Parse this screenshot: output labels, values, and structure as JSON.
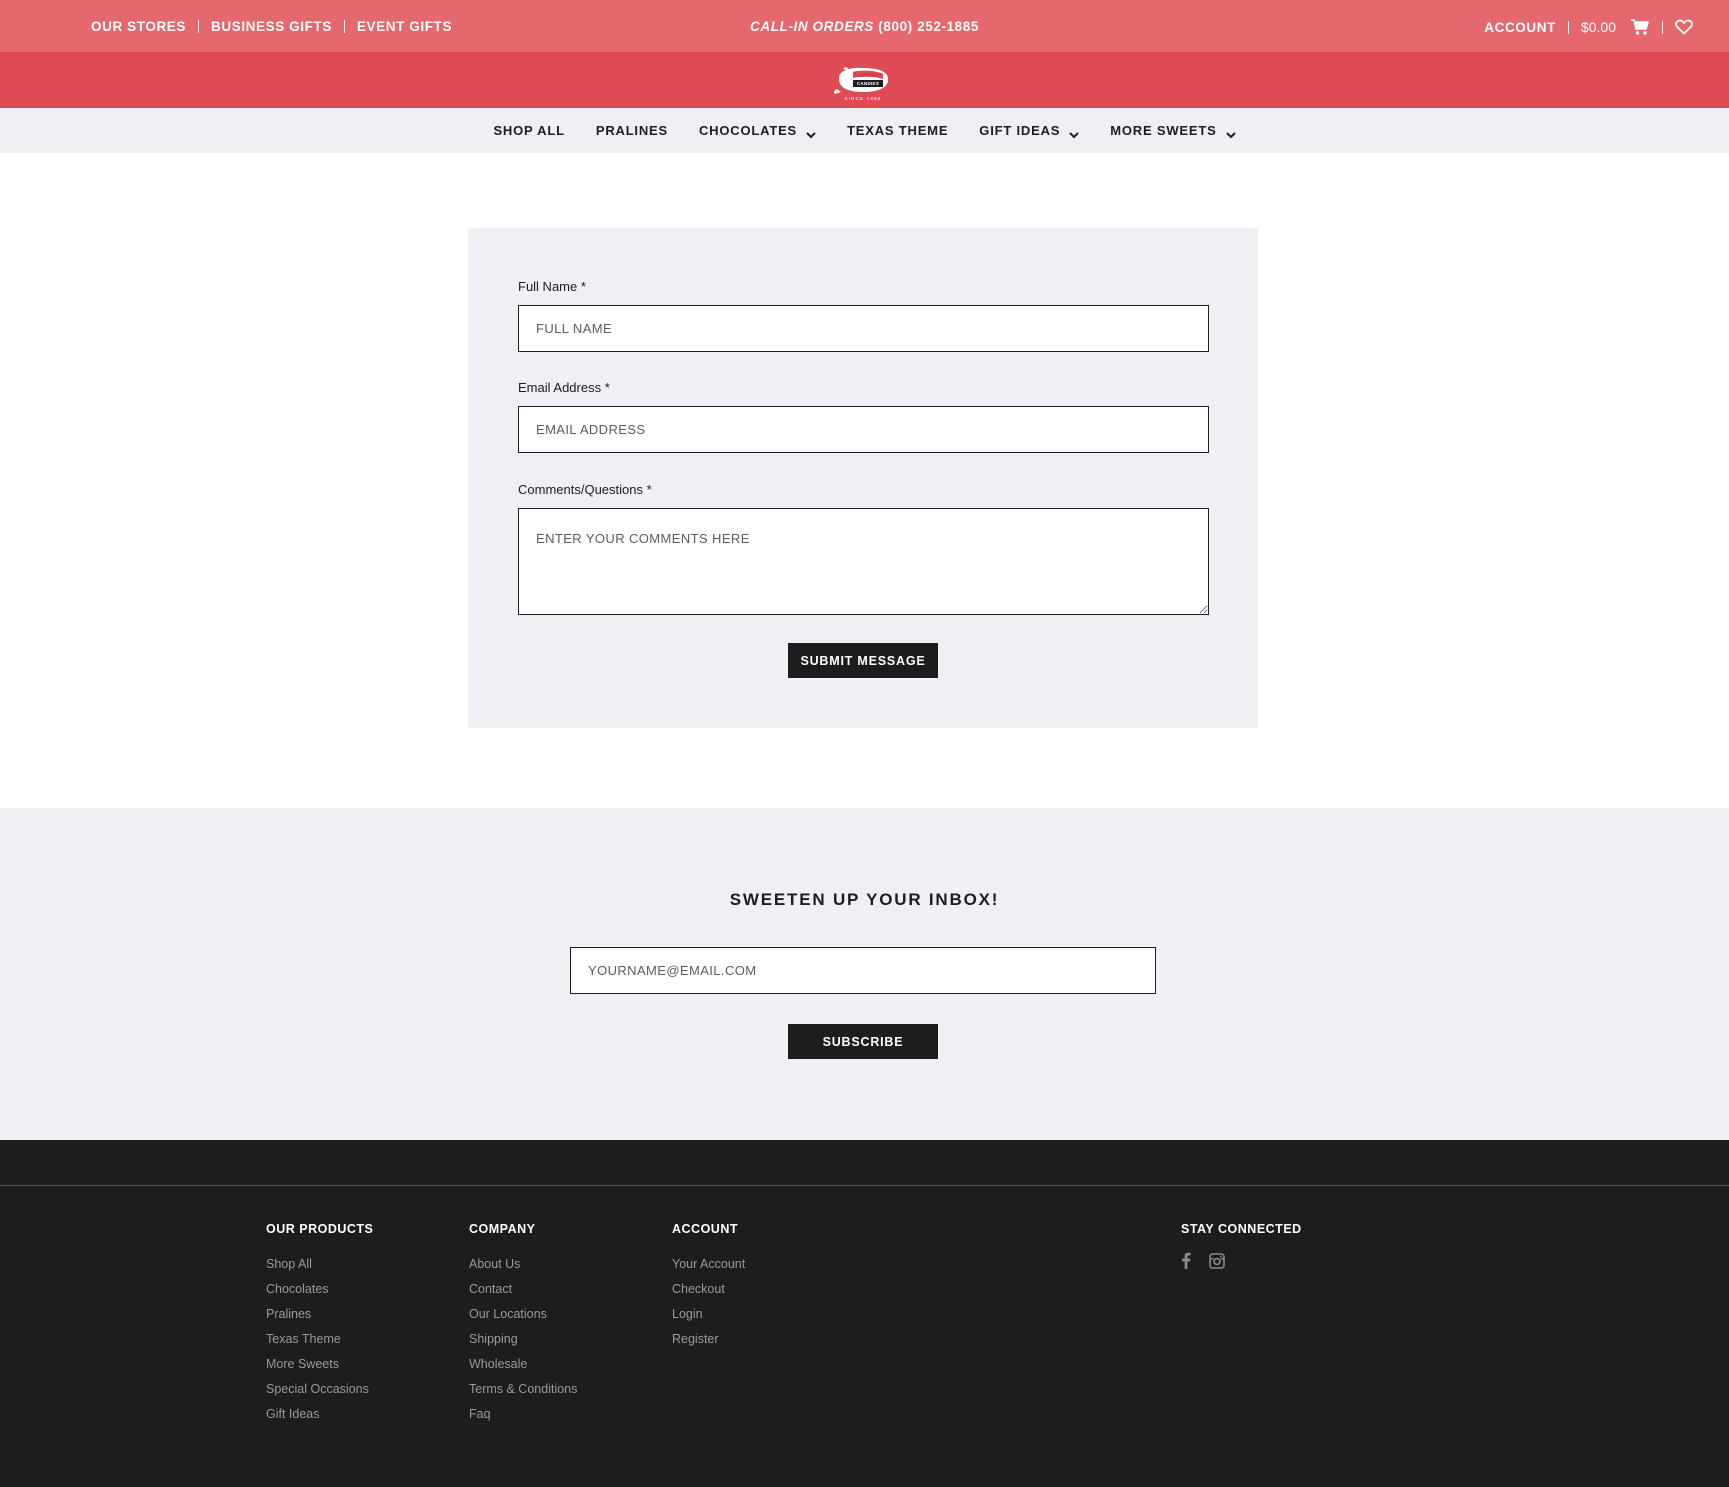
{
  "topbar": {
    "links": [
      "OUR STORES",
      "BUSINESS GIFTS",
      "EVENT GIFTS"
    ],
    "call_label": "CALL-IN ORDERS",
    "call_number": "(800) 252-1885",
    "account": "ACCOUNT",
    "cart_total": "$0.00",
    "cart_icon": "cart-icon",
    "wishlist_icon": "heart-icon"
  },
  "logo": {
    "name": "Lammes",
    "subtitle": "CANDIES",
    "since": "SINCE 1885"
  },
  "nav": {
    "items": [
      {
        "label": "SHOP ALL",
        "dropdown": false
      },
      {
        "label": "PRALINES",
        "dropdown": false
      },
      {
        "label": "CHOCOLATES",
        "dropdown": true
      },
      {
        "label": "TEXAS THEME",
        "dropdown": false
      },
      {
        "label": "GIFT IDEAS",
        "dropdown": true
      },
      {
        "label": "MORE SWEETS",
        "dropdown": true
      }
    ]
  },
  "form": {
    "full_name_label": "Full Name *",
    "full_name_placeholder": "FULL NAME",
    "email_label": "Email Address *",
    "email_placeholder": "EMAIL ADDRESS",
    "comments_label": "Comments/Questions *",
    "comments_placeholder": "ENTER YOUR COMMENTS HERE",
    "submit_label": "SUBMIT MESSAGE"
  },
  "newsletter": {
    "heading": "SWEETEN UP YOUR INBOX!",
    "email_placeholder": "YOURNAME@EMAIL.COM",
    "subscribe_label": "SUBSCRIBE"
  },
  "footer": {
    "products": {
      "heading": "OUR PRODUCTS",
      "links": [
        "Shop All",
        "Chocolates",
        "Pralines",
        "Texas Theme",
        "More Sweets",
        "Special Occasions",
        "Gift Ideas"
      ]
    },
    "company": {
      "heading": "COMPANY",
      "links": [
        "About Us",
        "Contact",
        "Our Locations",
        "Shipping",
        "Wholesale",
        "Terms & Conditions",
        "Faq"
      ]
    },
    "account": {
      "heading": "ACCOUNT",
      "links": [
        "Your Account",
        "Checkout",
        "Login",
        "Register"
      ]
    },
    "connect": {
      "heading": "STAY CONNECTED",
      "icons": [
        "facebook-icon",
        "instagram-icon"
      ]
    }
  },
  "colors": {
    "topbar": "#e5686f",
    "logoband": "#df4b55",
    "panel": "#eff0f3",
    "dark": "#1d1d1d",
    "footer_link": "#9a9a9a"
  }
}
